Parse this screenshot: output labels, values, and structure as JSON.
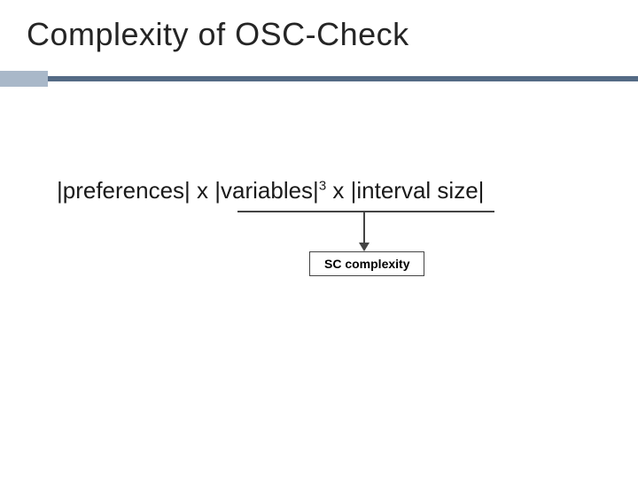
{
  "title": "Complexity of OSC-Check",
  "formula": {
    "t1": "|preferences| x |variables|",
    "superscript": "3",
    "t2": " x |interval size|"
  },
  "callout": "SC complexity"
}
